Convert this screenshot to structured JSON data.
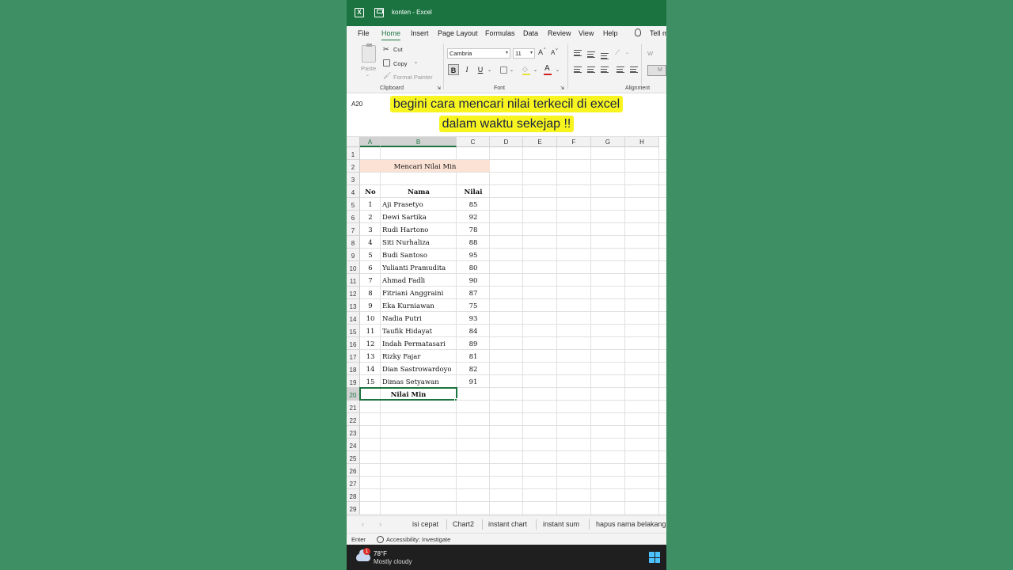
{
  "window": {
    "title": "konten - Excel",
    "app_badge": "X"
  },
  "menu": [
    "File",
    "Home",
    "Insert",
    "Page Layout",
    "Formulas",
    "Data",
    "Review",
    "View",
    "Help",
    "Tell m"
  ],
  "ribbon": {
    "clipboard": {
      "paste": "Paste",
      "cut": "Cut",
      "copy": "Copy",
      "format_painter": "Format Painter",
      "label": "Clipboard"
    },
    "font": {
      "name": "Cambria",
      "size": "11",
      "grow": "A",
      "shrink": "A",
      "bold": "B",
      "italic": "I",
      "underline": "U",
      "font_color": "A",
      "label": "Font"
    },
    "alignment": {
      "label": "Alignment",
      "wrap": "W",
      "merge": "M"
    }
  },
  "formula_bar": {
    "name_box": "A20"
  },
  "caption": {
    "line1": "begini cara mencari nilai terkecil di excel",
    "line2": "dalam waktu sekejap !!"
  },
  "grid": {
    "columns": [
      "A",
      "B",
      "C",
      "D",
      "E",
      "F",
      "G",
      "H"
    ],
    "rows": [
      "1",
      "2",
      "3",
      "4",
      "5",
      "6",
      "7",
      "8",
      "9",
      "10",
      "11",
      "12",
      "13",
      "14",
      "15",
      "16",
      "17",
      "18",
      "19",
      "20",
      "21",
      "22",
      "23",
      "24",
      "25",
      "26",
      "27",
      "28",
      "29"
    ],
    "table_title": "Mencari Nilai Min",
    "headers": {
      "no": "No",
      "nama": "Nama",
      "nilai": "Nilai"
    },
    "data": [
      {
        "no": "1",
        "nama": "Aji Prasetyo",
        "nilai": "85"
      },
      {
        "no": "2",
        "nama": "Dewi Sartika",
        "nilai": "92"
      },
      {
        "no": "3",
        "nama": "Rudi Hartono",
        "nilai": "78"
      },
      {
        "no": "4",
        "nama": "Siti Nurhaliza",
        "nilai": "88"
      },
      {
        "no": "5",
        "nama": "Budi Santoso",
        "nilai": "95"
      },
      {
        "no": "6",
        "nama": "Yulianti Pramudita",
        "nilai": "80"
      },
      {
        "no": "7",
        "nama": "Ahmad Fadli",
        "nilai": "90"
      },
      {
        "no": "8",
        "nama": "Fitriani Anggraini",
        "nilai": "87"
      },
      {
        "no": "9",
        "nama": "Eka Kurniawan",
        "nilai": "75"
      },
      {
        "no": "10",
        "nama": "Nadia Putri",
        "nilai": "93"
      },
      {
        "no": "11",
        "nama": "Taufik Hidayat",
        "nilai": "84"
      },
      {
        "no": "12",
        "nama": "Indah Permatasari",
        "nilai": "89"
      },
      {
        "no": "13",
        "nama": "Rizky Fajar",
        "nilai": "81"
      },
      {
        "no": "14",
        "nama": "Dian Sastrowardoyo",
        "nilai": "82"
      },
      {
        "no": "15",
        "nama": "Dimas Setyawan",
        "nilai": "91"
      }
    ],
    "min_label": "Nilai Min"
  },
  "sheet_tabs": [
    "isi cepat",
    "Chart2",
    "instant chart",
    "instant sum",
    "hapus nama belakang"
  ],
  "status": {
    "mode": "Enter",
    "accessibility": "Accessibility: Investigate"
  },
  "taskbar": {
    "temperature": "78°F",
    "weather": "Mostly cloudy",
    "badge": "1"
  },
  "colors": {
    "excel_green": "#1b7440",
    "background": "#3e8f63",
    "title_fill": "#fbe2d5",
    "caption_bg": "#f8f41f"
  }
}
